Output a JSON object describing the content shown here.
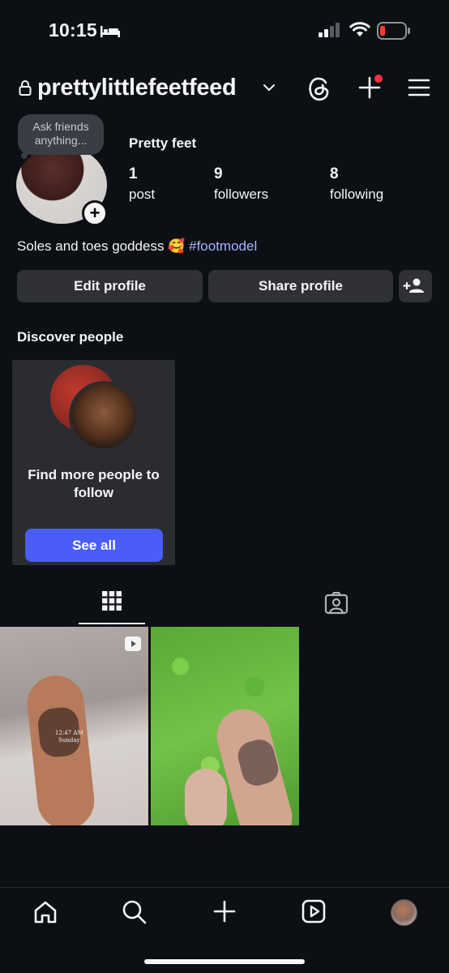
{
  "status_bar": {
    "time": "10:15"
  },
  "header": {
    "username": "prettylittlefeetfeed"
  },
  "profile": {
    "note": "Ask friends anything...",
    "display_name": "Pretty feet",
    "stats": [
      {
        "count": "1",
        "label": "post"
      },
      {
        "count": "9",
        "label": "followers"
      },
      {
        "count": "8",
        "label": "following"
      }
    ],
    "bio_text": "Soles and toes goddess",
    "bio_emoji": "🥰",
    "bio_hashtag": "#footmodel"
  },
  "buttons": {
    "edit": "Edit profile",
    "share": "Share profile"
  },
  "discover": {
    "title": "Discover people",
    "card_text": "Find more people to follow",
    "see_all": "See all"
  },
  "posts": [
    {
      "caption_time": "12:47 AM",
      "caption_day": "Sunday"
    }
  ],
  "colors": {
    "accent": "#4a5df9",
    "hashtag": "#a5b4ff",
    "notification": "#ff3040",
    "battery_low": "#ff3b30"
  }
}
